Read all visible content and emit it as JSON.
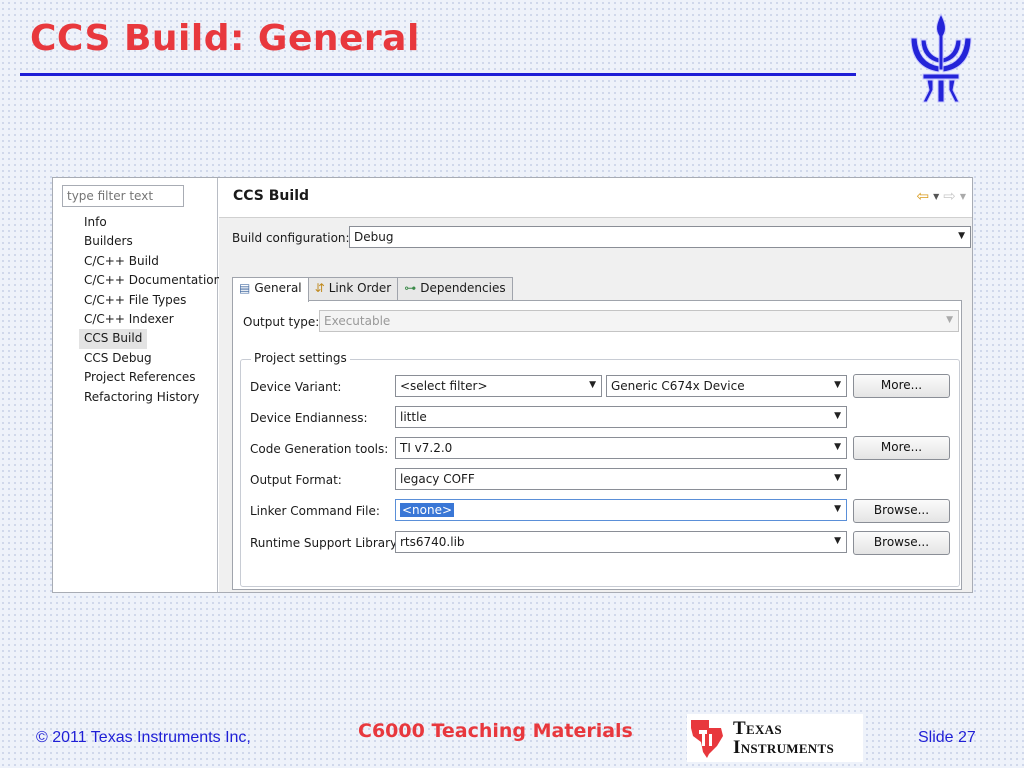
{
  "slide": {
    "title": "CCS Build: General",
    "colors": {
      "title": "#e8383d",
      "rule": "#1f1fd6",
      "footer_text": "#1f1fd6"
    }
  },
  "sidebar": {
    "filter_placeholder": "type filter text",
    "items": [
      {
        "label": "Info"
      },
      {
        "label": "Builders"
      },
      {
        "label": "C/C++ Build"
      },
      {
        "label": "C/C++ Documentation"
      },
      {
        "label": "C/C++ File Types"
      },
      {
        "label": "C/C++ Indexer"
      },
      {
        "label": "CCS Build"
      },
      {
        "label": "CCS Debug"
      },
      {
        "label": "Project References"
      },
      {
        "label": "Refactoring History"
      }
    ],
    "selected": "CCS Build"
  },
  "panel": {
    "title": "CCS Build",
    "build_config_label": "Build configuration:",
    "build_config_value": "Debug",
    "tabs": [
      {
        "label": "General",
        "icon": "properties-icon"
      },
      {
        "label": "Link Order",
        "icon": "link-order-icon"
      },
      {
        "label": "Dependencies",
        "icon": "dependencies-icon"
      }
    ],
    "output_type_label": "Output type:",
    "output_type_value": "Executable",
    "project_settings": {
      "legend": "Project settings",
      "device_variant_label": "Device Variant:",
      "device_filter_value": "<select filter>",
      "device_value": "Generic C674x Device",
      "device_more": "More...",
      "endianness_label": "Device Endianness:",
      "endianness_value": "little",
      "codegen_label": "Code Generation tools:",
      "codegen_value": "TI v7.2.0",
      "codegen_more": "More...",
      "output_format_label": "Output Format:",
      "output_format_value": "legacy COFF",
      "linker_cmd_label": "Linker Command File:",
      "linker_cmd_value": "<none>",
      "linker_browse": "Browse...",
      "rts_label": "Runtime Support Library:",
      "rts_value": "rts6740.lib",
      "rts_browse": "Browse..."
    }
  },
  "footer": {
    "copyright": "© 2011 Texas Instruments Inc,",
    "center": "C6000 Teaching Materials",
    "logo_line1": "Texas",
    "logo_line2": "Instruments",
    "slide_number": "Slide 27"
  }
}
